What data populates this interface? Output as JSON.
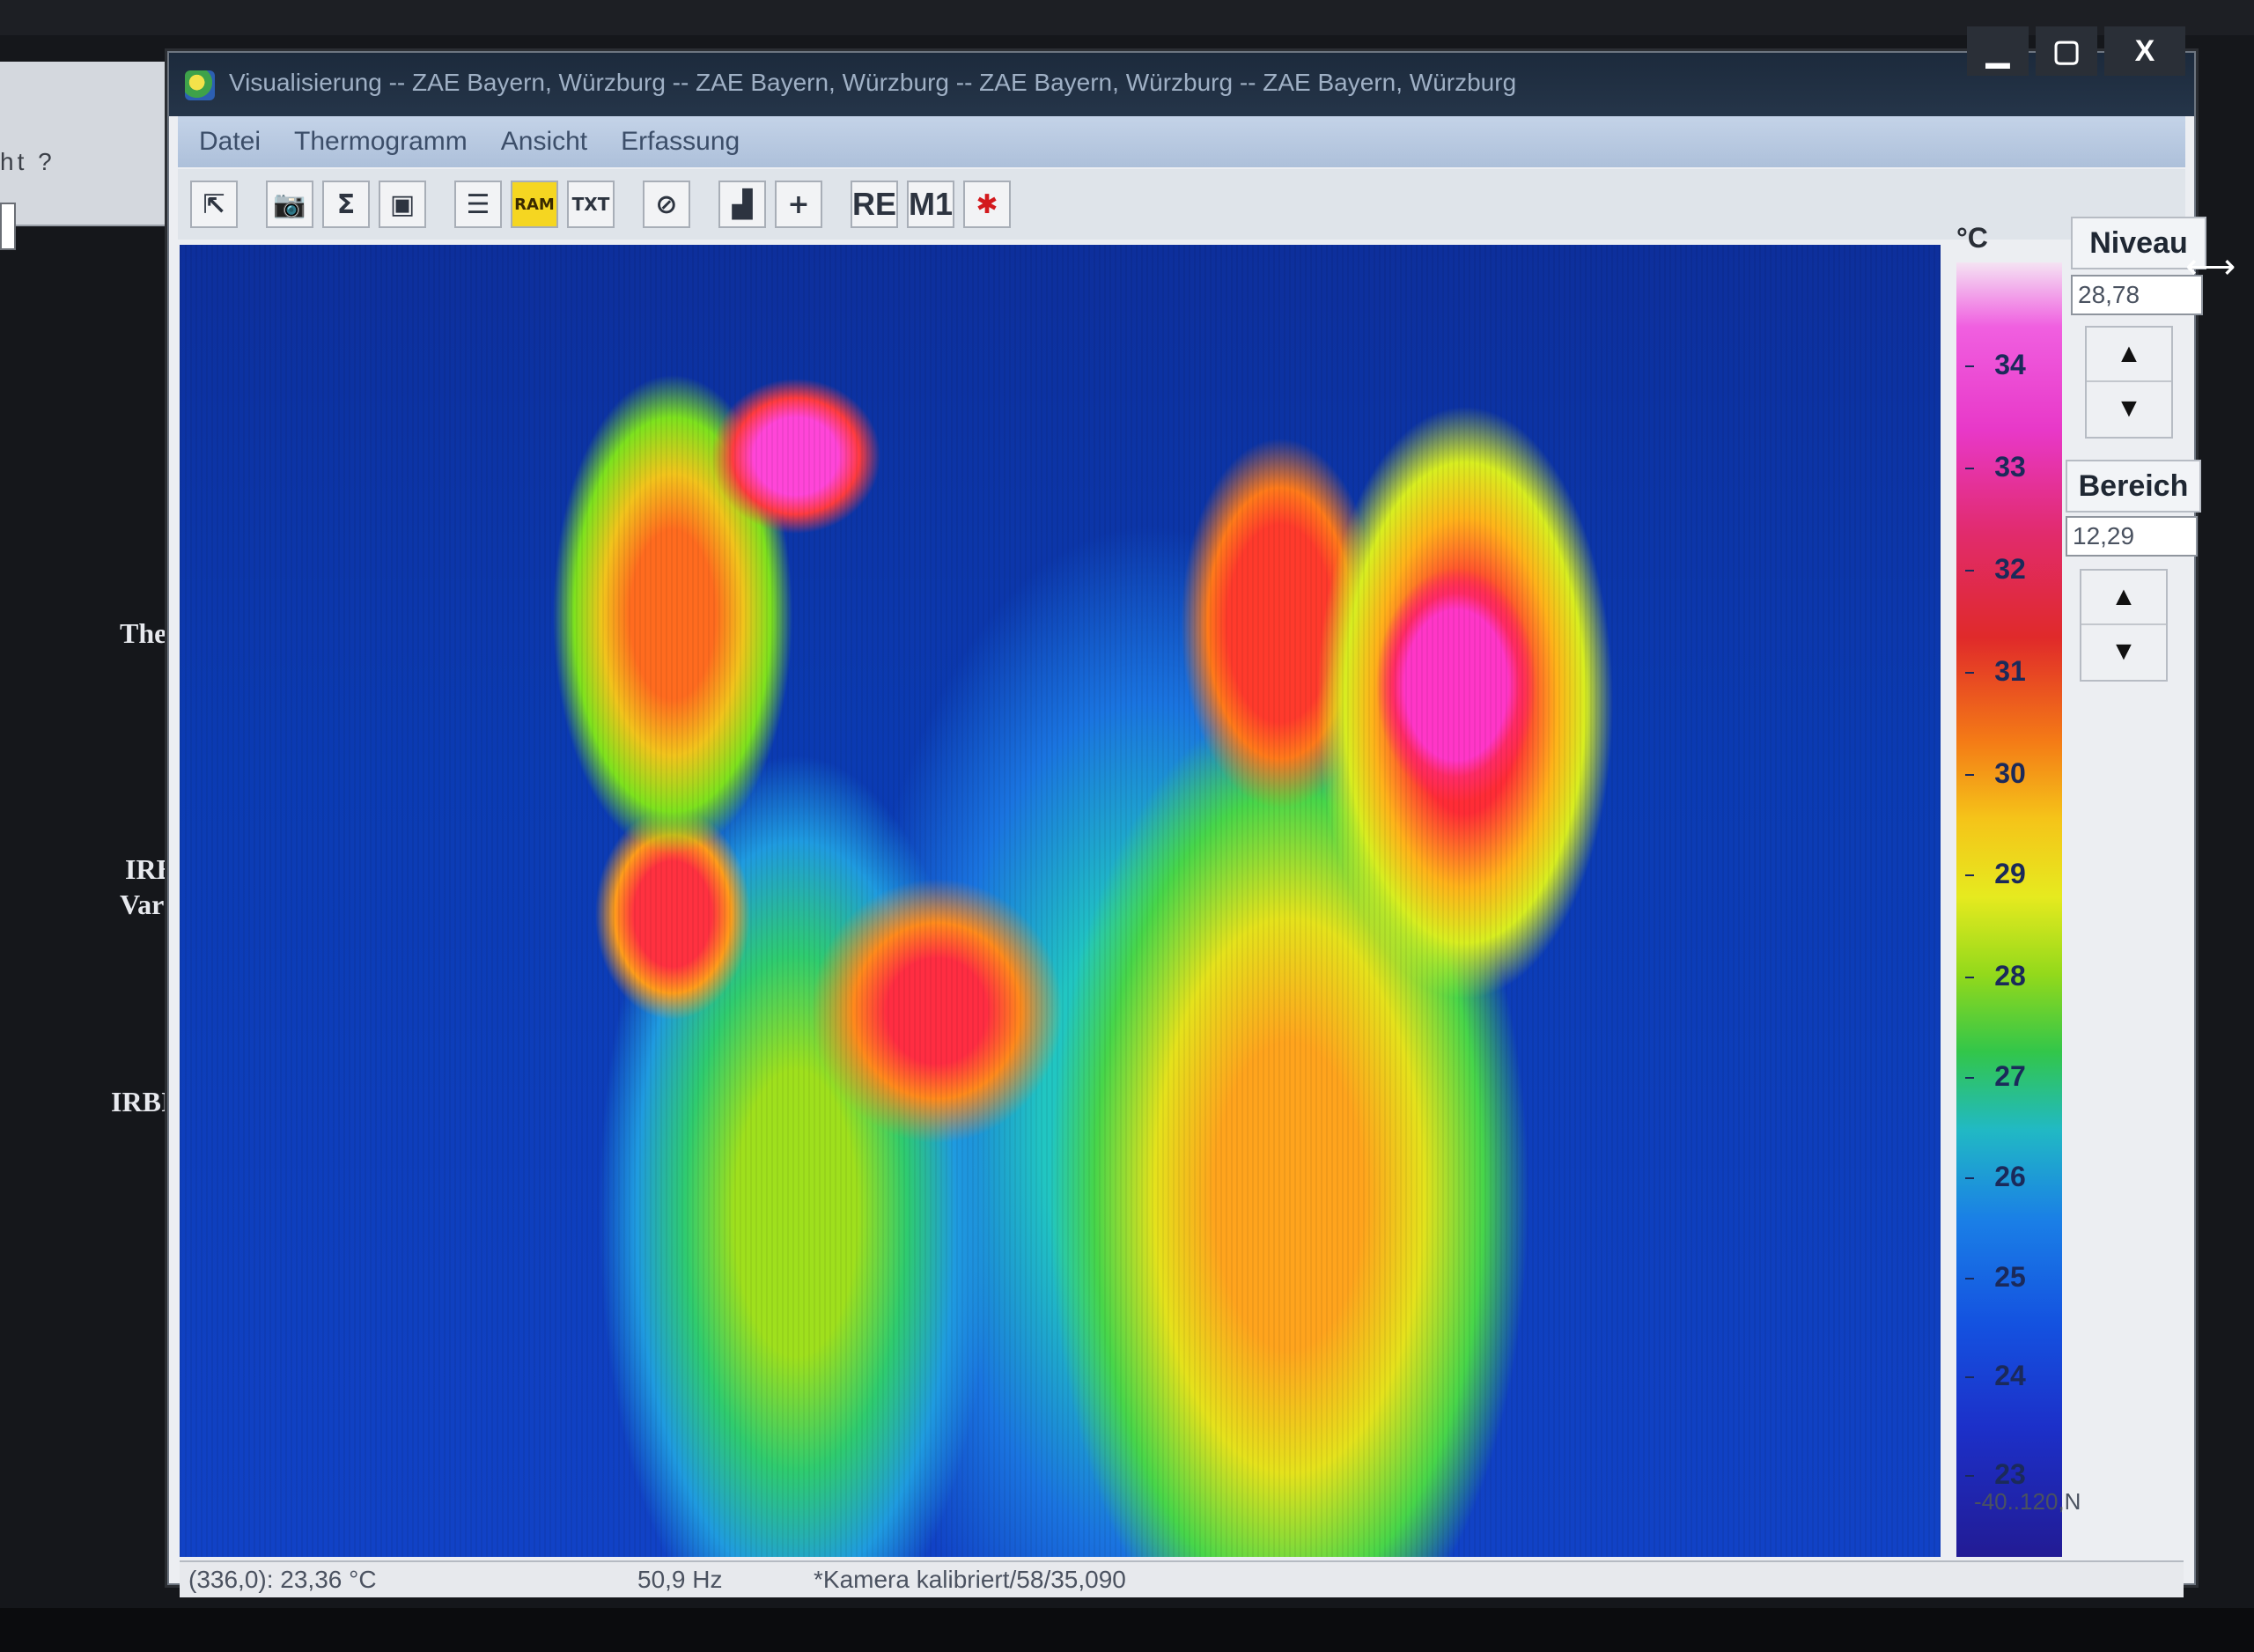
{
  "background": {
    "menu_text": "ht   ?",
    "side_labels": [
      "Ther",
      "IRBI",
      "Vario",
      "IRBIS",
      "N"
    ]
  },
  "window": {
    "title": "Visualisierung -- ZAE Bayern, Würzburg -- ZAE Bayern, Würzburg -- ZAE Bayern, Würzburg -- ZAE Bayern, Würzburg",
    "controls": {
      "minimize": "▁",
      "maximize": "▢",
      "close": "X"
    }
  },
  "menu": [
    "Datei",
    "Thermogramm",
    "Ansicht",
    "Erfassung"
  ],
  "toolbar": {
    "icons": [
      "export-icon",
      "camera-icon",
      "sum-icon",
      "monitor-icon",
      "list-icon",
      "ram-icon",
      "txt-icon",
      "disk-icon",
      "chart-icon",
      "crosshair-icon",
      "re-icon",
      "m1-icon",
      "cross-marker-icon"
    ],
    "ram_label": "RAM",
    "txt_label": "TXT",
    "re_label": "RE",
    "m1_label": "M1",
    "sum_symbol": "Σ"
  },
  "scale": {
    "unit": "°C",
    "ticks": [
      "34",
      "33",
      "32",
      "31",
      "30",
      "29",
      "28",
      "27",
      "26",
      "25",
      "24",
      "23"
    ],
    "range_text": "-40..120,N"
  },
  "panel": {
    "niveau_label": "Niveau",
    "niveau_value": "28,78",
    "bereich_label": "Bereich",
    "bereich_value": "12,29"
  },
  "status": {
    "cursor": "(336,0): 23,36 °C",
    "frequency": "50,9 Hz",
    "calibration": "*Kamera kalibriert/58/35,090"
  }
}
